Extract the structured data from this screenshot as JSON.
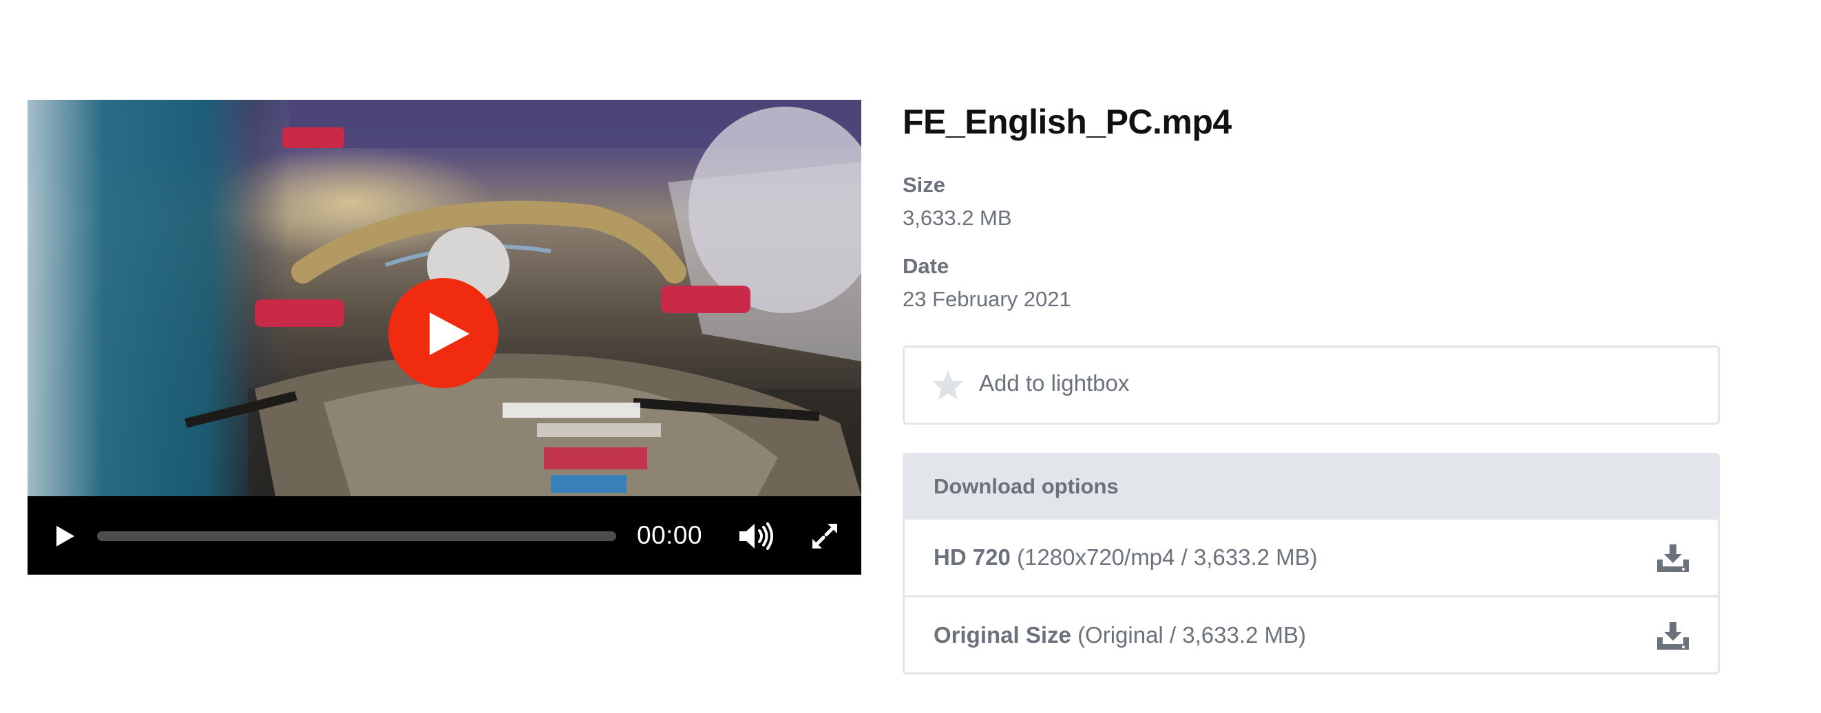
{
  "player": {
    "current_time": "00:00",
    "progress": 0.0
  },
  "file": {
    "title": "FE_English_PC.mp4",
    "size_label": "Size",
    "size_value": "3,633.2 MB",
    "date_label": "Date",
    "date_value": "23 February 2021"
  },
  "lightbox": {
    "label": "Add to lightbox",
    "icon": "star-icon"
  },
  "downloads": {
    "header": "Download options",
    "options": [
      {
        "name": "HD 720",
        "detail": "(1280x720/mp4 / 3,633.2 MB)",
        "icon": "download-icon"
      },
      {
        "name": "Original Size",
        "detail": "(Original / 3,633.2 MB)",
        "icon": "download-icon"
      }
    ]
  },
  "colors": {
    "play_button": "#f12b0f",
    "text_muted": "#6b727c",
    "border": "#e2e5e9",
    "title": "#111111"
  }
}
